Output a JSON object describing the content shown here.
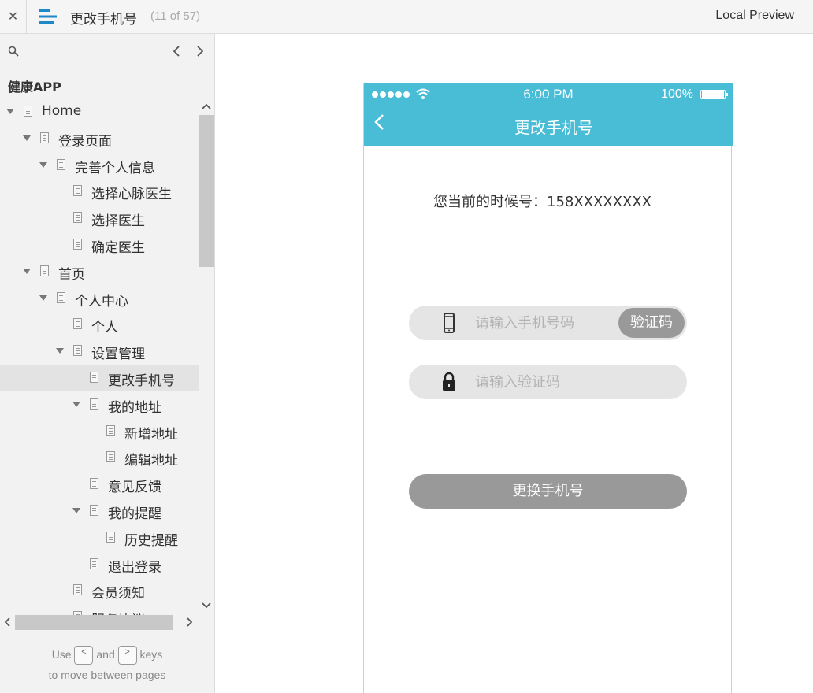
{
  "topbar": {
    "close_glyph": "✕",
    "title": "更改手机号",
    "page_counter": "(11 of 57)",
    "local_preview": "Local Preview"
  },
  "sidebar": {
    "project_name": "健康APP",
    "tree": [
      {
        "label": "Home",
        "depth": 0,
        "expandable": true
      },
      {
        "label": "登录页面",
        "depth": 1,
        "expandable": true
      },
      {
        "label": "完善个人信息",
        "depth": 2,
        "expandable": true
      },
      {
        "label": "选择心脉医生",
        "depth": 3,
        "expandable": false
      },
      {
        "label": "选择医生",
        "depth": 3,
        "expandable": false
      },
      {
        "label": "确定医生",
        "depth": 3,
        "expandable": false
      },
      {
        "label": "首页",
        "depth": 1,
        "expandable": true
      },
      {
        "label": "个人中心",
        "depth": 2,
        "expandable": true
      },
      {
        "label": "个人",
        "depth": 3,
        "expandable": false
      },
      {
        "label": "设置管理",
        "depth": 3,
        "expandable": true
      },
      {
        "label": "更改手机号",
        "depth": 4,
        "expandable": false,
        "active": true
      },
      {
        "label": "我的地址",
        "depth": 4,
        "expandable": true
      },
      {
        "label": "新增地址",
        "depth": 5,
        "expandable": false
      },
      {
        "label": "编辑地址",
        "depth": 5,
        "expandable": false
      },
      {
        "label": "意见反馈",
        "depth": 4,
        "expandable": false
      },
      {
        "label": "我的提醒",
        "depth": 4,
        "expandable": true
      },
      {
        "label": "历史提醒",
        "depth": 5,
        "expandable": false
      },
      {
        "label": "退出登录",
        "depth": 4,
        "expandable": false
      },
      {
        "label": "会员须知",
        "depth": 3,
        "expandable": false
      },
      {
        "label": "服务协议",
        "depth": 3,
        "expandable": false
      }
    ],
    "hint": {
      "use": "Use",
      "and": "and",
      "keys": "keys",
      "line2": "to move between pages",
      "key_prev": "<",
      "key_next": ">"
    }
  },
  "phone": {
    "status": {
      "time": "6:00 PM",
      "battery": "100%"
    },
    "nav_title": "更改手机号",
    "current_phone_text": "您当前的时候号：158XXXXXXXX",
    "phone_input_placeholder": "请输入手机号码",
    "code_button": "验证码",
    "code_input_placeholder": "请输入验证码",
    "submit_button": "更换手机号"
  },
  "colors": {
    "accent": "#49bdd6",
    "button_gray": "#999999",
    "field_bg": "#e5e5e5",
    "menu_icon": "#1e88c8"
  },
  "icons": {
    "close": "close-icon",
    "menu": "menu-icon",
    "search": "search-icon",
    "prev": "chevron-left-icon",
    "next": "chevron-right-icon",
    "back": "back-chevron-icon",
    "phone_field": "mobile-phone-icon",
    "code_field": "lock-icon"
  }
}
